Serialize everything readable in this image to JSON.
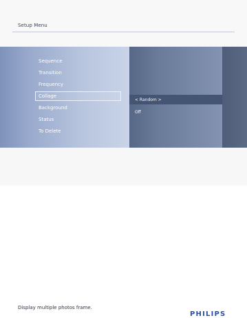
{
  "header": {
    "title": "Setup Menu"
  },
  "menu": {
    "items": [
      {
        "label": "Sequence"
      },
      {
        "label": "Transition"
      },
      {
        "label": "Frequency"
      },
      {
        "label": "Collage",
        "selected": true
      },
      {
        "label": "Background"
      },
      {
        "label": "Status"
      },
      {
        "label": "To Delete"
      }
    ]
  },
  "options": {
    "items": [
      {
        "label": "< Random >",
        "highlighted": true
      },
      {
        "label": "Off"
      }
    ]
  },
  "footer": {
    "help_text": "Display multiple photos frame.",
    "brand": "PHILIPS"
  },
  "colors": {
    "brand": "#2a4fa3",
    "menu_panel": "#a3b2d2",
    "options_panel": "#6a7b99",
    "highlight_row": "#445473"
  }
}
